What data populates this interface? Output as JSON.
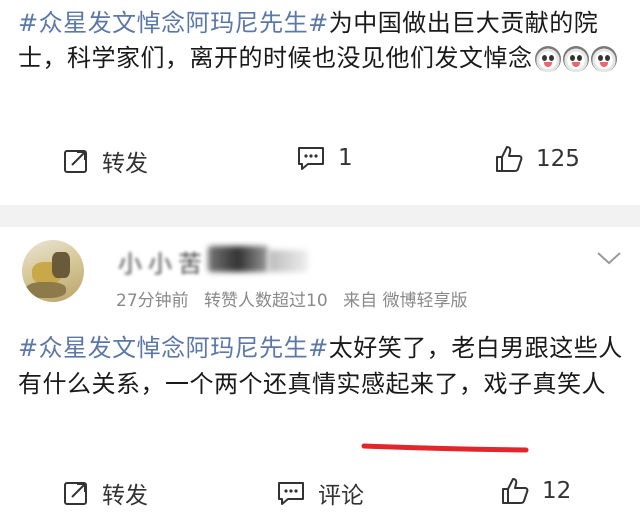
{
  "post1": {
    "hashtag": "#众星发文悼念阿玛尼先生#",
    "text": "为中国做出巨大贡献的院士，科学家们，离开的时候也没见他们发文悼念",
    "emoji_count": 3,
    "actions": {
      "repost_label": "转发",
      "comment_count": "1",
      "like_count": "125"
    }
  },
  "post2": {
    "username": "小小苦",
    "meta": {
      "time": "27分钟前",
      "reposts": "转赞人数超过10",
      "source": "来自 微博轻享版"
    },
    "hashtag": "#众星发文悼念阿玛尼先生#",
    "text": "太好笑了，老白男跟这些人有什么关系，一个两个还真情实感起来了，戏子真笑人",
    "actions": {
      "repost_label": "转发",
      "comment_label": "评论",
      "like_count": "12"
    }
  },
  "colors": {
    "hashtag": "#5c78a8",
    "underline": "#e3262b",
    "divider": "#f2f2f2"
  },
  "icons": [
    "repost-icon",
    "comment-icon",
    "like-icon",
    "chevron-down-icon",
    "emoji-icon"
  ]
}
